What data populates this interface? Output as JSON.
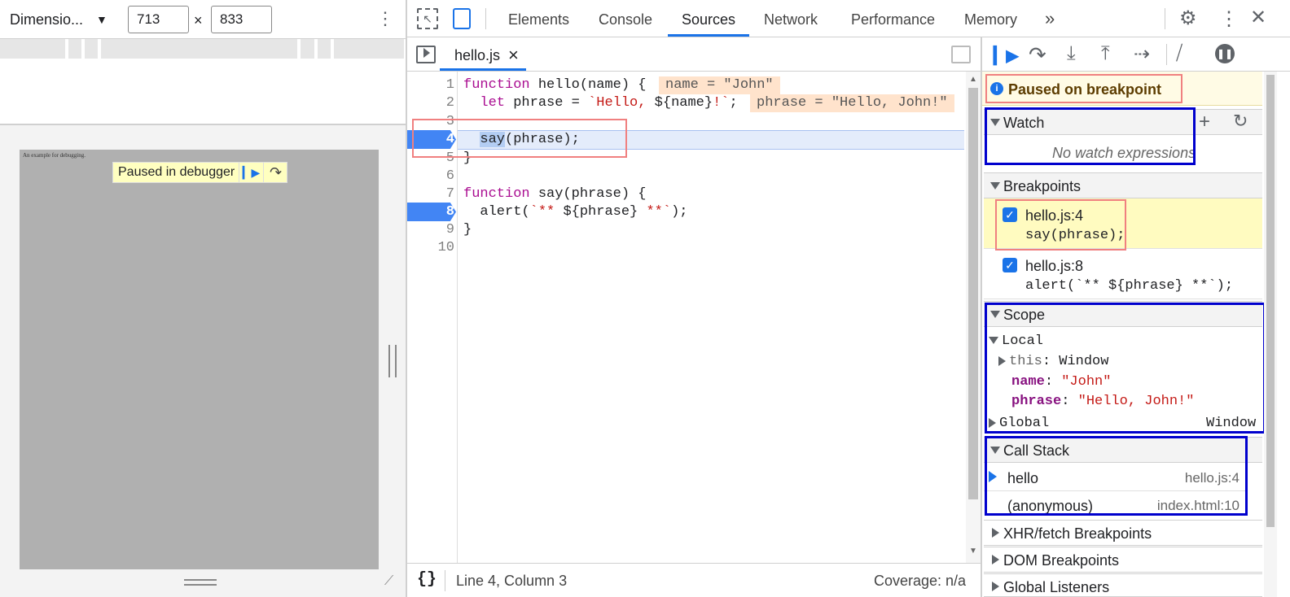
{
  "device_toolbar": {
    "dimensions_label": "Dimensio...",
    "width": "713",
    "height": "833",
    "times": "×"
  },
  "preview": {
    "page_text": "An example for debugging.",
    "paused_label": "Paused in debugger"
  },
  "tabs": [
    {
      "label": "Elements"
    },
    {
      "label": "Console"
    },
    {
      "label": "Sources"
    },
    {
      "label": "Network"
    },
    {
      "label": "Performance"
    },
    {
      "label": "Memory"
    }
  ],
  "more_tabs": "»",
  "active_tab": "Sources",
  "editor": {
    "file_tab": "hello.js",
    "close": "×",
    "line_numbers": [
      "1",
      "2",
      "3",
      "4",
      "5",
      "6",
      "7",
      "8",
      "9",
      "10"
    ],
    "lines": [
      {
        "kw": "function",
        "rest": " hello(name) {"
      },
      {
        "pre": "  ",
        "kw": "let",
        "mid": " phrase = ",
        "str": "`Hello, ",
        "tmpl": "${name}",
        "str2": "!`",
        "end": ";"
      },
      {
        "text": ""
      },
      {
        "pre": "  ",
        "sel": "say",
        "rest": "(phrase);"
      },
      {
        "text": "}"
      },
      {
        "text": ""
      },
      {
        "kw": "function",
        "rest": " say(phrase) {"
      },
      {
        "pre": "  alert(",
        "str": "`** ",
        "tmpl": "${phrase}",
        "str2": " **`",
        "end": ");"
      },
      {
        "text": "}"
      },
      {
        "text": ""
      }
    ],
    "inline_values": [
      "name = \"John\"",
      "phrase = \"Hello, John!\""
    ],
    "status_position": "Line 4, Column 3",
    "status_coverage": "Coverage: n/a",
    "format_icon": "{}"
  },
  "debugger": {
    "paused_message": "Paused on breakpoint",
    "watch": {
      "title": "Watch",
      "empty": "No watch expressions"
    },
    "breakpoints": {
      "title": "Breakpoints",
      "items": [
        {
          "file": "hello.js:4",
          "code": "say(phrase);",
          "checked": true,
          "active": true
        },
        {
          "file": "hello.js:8",
          "code": "alert(`** ${phrase} **`);",
          "checked": true,
          "active": false
        }
      ]
    },
    "scope": {
      "title": "Scope",
      "local": "Local",
      "vars": [
        {
          "name": "this",
          "sep": ": ",
          "value": "Window"
        },
        {
          "name": "name",
          "sep": ": ",
          "value": "\"John\""
        },
        {
          "name": "phrase",
          "sep": ": ",
          "value": "\"Hello, John!\""
        }
      ],
      "global": "Global",
      "global_value": "Window"
    },
    "call_stack": {
      "title": "Call Stack",
      "frames": [
        {
          "name": "hello",
          "location": "hello.js:4",
          "current": true
        },
        {
          "name": "(anonymous)",
          "location": "index.html:10",
          "current": false
        }
      ]
    },
    "collapsed_sections": [
      "XHR/fetch Breakpoints",
      "DOM Breakpoints",
      "Global Listeners"
    ]
  },
  "colors": {
    "accent": "#1a73e8",
    "paused_bg": "#fffbe5",
    "highlight_red": "#f08080",
    "highlight_blue": "#0000cd"
  }
}
